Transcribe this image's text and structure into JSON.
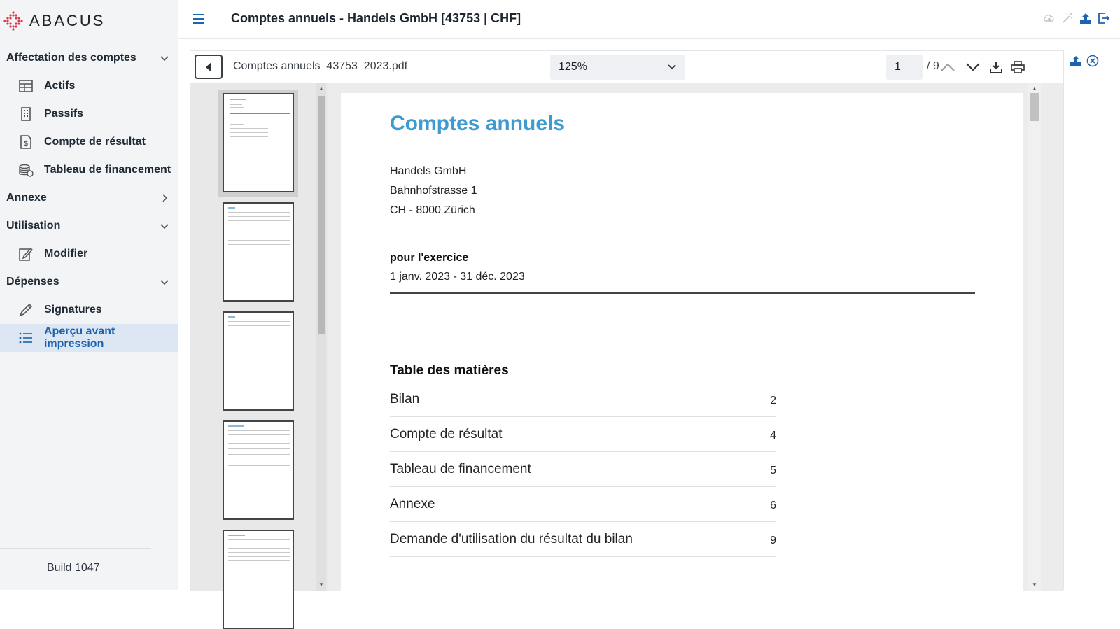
{
  "app": {
    "logo_text": "ABACUS",
    "build": "Build 1047"
  },
  "sidebar": {
    "items": [
      {
        "type": "group",
        "label": "Affectation des comptes",
        "expanded": true
      },
      {
        "type": "item",
        "label": "Actifs",
        "icon": "table-icon"
      },
      {
        "type": "item",
        "label": "Passifs",
        "icon": "building-icon"
      },
      {
        "type": "item",
        "label": "Compte de résultat",
        "icon": "document-dollar-icon"
      },
      {
        "type": "item",
        "label": "Tableau de financement",
        "icon": "coins-icon"
      },
      {
        "type": "group",
        "label": "Annexe",
        "expanded": false
      },
      {
        "type": "group",
        "label": "Utilisation",
        "expanded": true
      },
      {
        "type": "item",
        "label": "Modifier",
        "icon": "edit-icon"
      },
      {
        "type": "group",
        "label": "Dépenses",
        "expanded": true
      },
      {
        "type": "item",
        "label": "Signatures",
        "icon": "pen-icon"
      },
      {
        "type": "item",
        "label": "Aperçu avant impression",
        "icon": "list-icon",
        "active": true
      }
    ]
  },
  "header": {
    "title": "Comptes annuels - Handels GmbH [43753 | CHF]"
  },
  "viewer": {
    "filename": "Comptes annuels_43753_2023.pdf",
    "zoom": "125%",
    "page_current": "1",
    "page_total": "/ 9"
  },
  "document": {
    "title": "Comptes annuels",
    "address": [
      "Handels GmbH",
      "Bahnhofstrasse 1",
      "CH - 8000 Zürich"
    ],
    "period_label": "pour l'exercice",
    "period": "1 janv. 2023 - 31 déc. 2023",
    "toc_title": "Table des matières",
    "toc": [
      {
        "label": "Bilan",
        "page": "2"
      },
      {
        "label": "Compte de résultat",
        "page": "4"
      },
      {
        "label": "Tableau de financement",
        "page": "5"
      },
      {
        "label": "Annexe",
        "page": "6"
      },
      {
        "label": "Demande d'utilisation du résultat du bilan",
        "page": "9"
      }
    ]
  },
  "colors": {
    "accent": "#1e63b0",
    "doc_title": "#3d9bd0",
    "active_bg": "#dde7f3"
  }
}
